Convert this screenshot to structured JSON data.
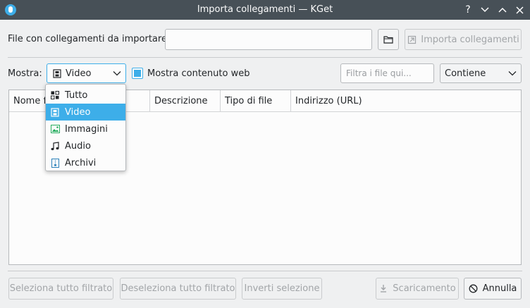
{
  "window": {
    "title": "Importa collegamenti — KGet",
    "help_glyph": "?"
  },
  "file_row": {
    "label": "File con collegamenti da importare:",
    "input_value": "",
    "import_button": "Importa collegamenti"
  },
  "filter_row": {
    "show_label": "Mostra:",
    "selected_filter": "Video",
    "web_content_label": "Mostra contenuto web",
    "web_content_checked": true,
    "search_placeholder": "Filtra i file qui...",
    "match_mode": "Contiene"
  },
  "dropdown": {
    "items": [
      {
        "label": "Tutto",
        "icon": "grid-icon"
      },
      {
        "label": "Video",
        "icon": "film-icon"
      },
      {
        "label": "Immagini",
        "icon": "image-icon"
      },
      {
        "label": "Audio",
        "icon": "music-note-icon"
      },
      {
        "label": "Archivi",
        "icon": "archive-icon"
      }
    ],
    "selected_index": 1
  },
  "table": {
    "columns": [
      {
        "label": "Nome f"
      },
      {
        "label": "Descrizione"
      },
      {
        "label": "Tipo di file"
      },
      {
        "label": "Indirizzo (URL)"
      }
    ]
  },
  "footer": {
    "select_all_filtered": "Seleziona tutto filtrato",
    "deselect_all_filtered": "Deseleziona tutto filtrato",
    "invert_selection": "Inverti selezione",
    "download": "Scaricamento",
    "cancel": "Annulla"
  },
  "colors": {
    "accent": "#3daee9",
    "titlebar": "#475057",
    "window_bg": "#eff0f1"
  }
}
